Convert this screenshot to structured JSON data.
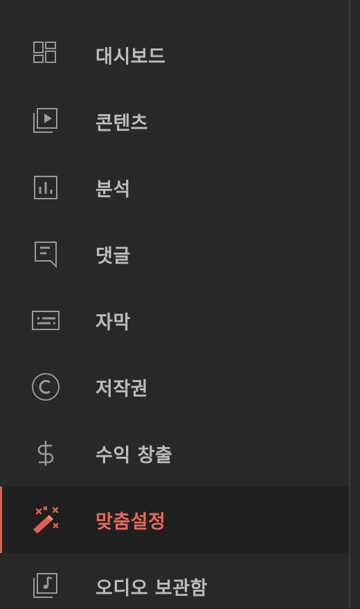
{
  "colors": {
    "background": "#282828",
    "active_background": "#1f1f1f",
    "text": "#bdbdbd",
    "icon": "#9a9a9a",
    "accent": "#e0604f"
  },
  "nav": {
    "items": [
      {
        "label": "대시보드",
        "icon": "dashboard-icon",
        "active": false
      },
      {
        "label": "콘텐츠",
        "icon": "content-icon",
        "active": false
      },
      {
        "label": "분석",
        "icon": "analytics-icon",
        "active": false
      },
      {
        "label": "댓글",
        "icon": "comments-icon",
        "active": false
      },
      {
        "label": "자막",
        "icon": "subtitles-icon",
        "active": false
      },
      {
        "label": "저작권",
        "icon": "copyright-icon",
        "active": false
      },
      {
        "label": "수익 창출",
        "icon": "monetization-icon",
        "active": false
      },
      {
        "label": "맞춤설정",
        "icon": "customization-icon",
        "active": true
      },
      {
        "label": "오디오 보관함",
        "icon": "audio-library-icon",
        "active": false
      }
    ]
  }
}
